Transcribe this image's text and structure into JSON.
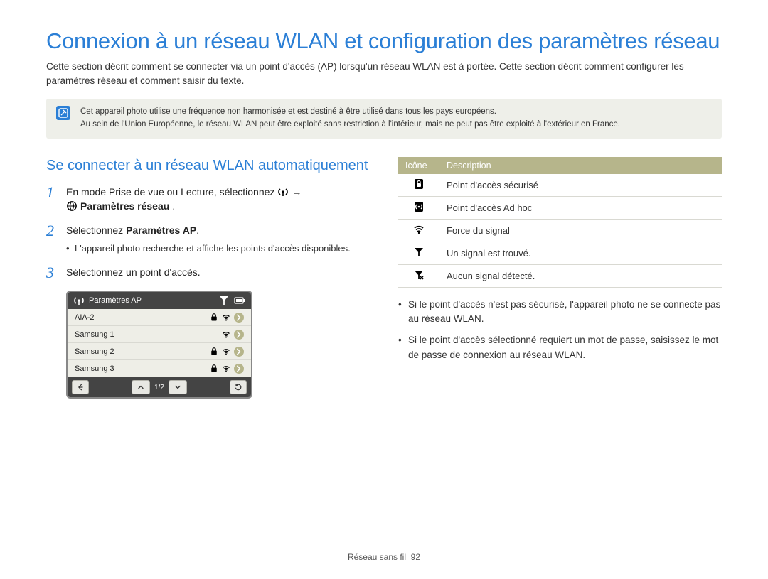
{
  "title": "Connexion à un réseau WLAN et configuration des paramètres réseau",
  "intro": "Cette section décrit comment se connecter via un point d'accès (AP) lorsqu'un réseau WLAN est à portée. Cette section décrit comment configurer les paramètres réseau et comment saisir du texte.",
  "note": {
    "line1": "Cet appareil photo utilise une fréquence non harmonisée et est destiné à être utilisé dans tous les pays européens.",
    "line2": "Au sein de l'Union Européenne, le réseau WLAN peut être exploité sans restriction à l'intérieur, mais ne peut pas être exploité à l'extérieur en France."
  },
  "left": {
    "subheading": "Se connecter à un réseau WLAN automatiquement",
    "step1": {
      "num": "1",
      "pre": "En mode Prise de vue ou Lecture, sélectionnez",
      "arrow": "→",
      "post_bold": "Paramètres réseau",
      "post_dot": "."
    },
    "step2": {
      "num": "2",
      "text_pre": "Sélectionnez ",
      "text_bold": "Paramètres AP",
      "text_post": ".",
      "sub": "L'appareil photo recherche et affiche les points d'accès disponibles."
    },
    "step3": {
      "num": "3",
      "text": "Sélectionnez un point d'accès."
    },
    "device": {
      "top_title": "Paramètres AP",
      "rows": [
        {
          "name": "AIA-2",
          "lock": true,
          "wifi": true
        },
        {
          "name": "Samsung 1",
          "lock": false,
          "wifi": true
        },
        {
          "name": "Samsung 2",
          "lock": true,
          "wifi": true
        },
        {
          "name": "Samsung 3",
          "lock": true,
          "wifi": true
        }
      ],
      "page": "1/2"
    }
  },
  "right": {
    "table": {
      "h_icon": "Icône",
      "h_desc": "Description",
      "rows": [
        {
          "icon": "lock",
          "desc": "Point d'accès sécurisé"
        },
        {
          "icon": "adhoc",
          "desc": "Point d'accès Ad hoc"
        },
        {
          "icon": "wifi",
          "desc": "Force du signal"
        },
        {
          "icon": "antenna-on",
          "desc": "Un signal est trouvé."
        },
        {
          "icon": "antenna-off",
          "desc": "Aucun signal détecté."
        }
      ]
    },
    "bullets": [
      "Si le point d'accès n'est pas sécurisé, l'appareil photo ne se connecte pas au réseau WLAN.",
      "Si le point d'accès sélectionné requiert un mot de passe, saisissez le mot de passe de connexion au réseau WLAN."
    ]
  },
  "footer": {
    "section": "Réseau sans fil",
    "page": "92"
  }
}
